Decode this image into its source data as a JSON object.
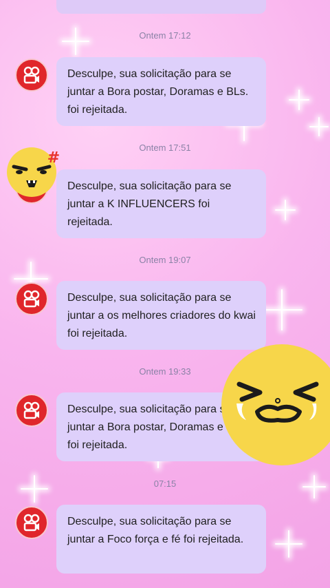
{
  "messages": [
    {
      "time": "Ontem 17:12",
      "text": "Desculpe, sua solicitação para se juntar a Bora postar, Doramas e BLs. foi rejeitada."
    },
    {
      "time": "Ontem 17:51",
      "text": "Desculpe, sua solicitação para se juntar a K INFLUENCERS foi rejeitada."
    },
    {
      "time": "Ontem 19:07",
      "text": "Desculpe, sua solicitação para se juntar a os melhores criadores do kwai foi rejeitada."
    },
    {
      "time": "Ontem 19:33",
      "text": "Desculpe, sua solicitação para se juntar a Bora postar, Doramas e BLs. foi rejeitada."
    },
    {
      "time": "07:15",
      "text": "Desculpe, sua solicitação para se juntar a Foco força e fé foi rejeitada."
    }
  ],
  "stickers": {
    "angry_mark": "#",
    "angry_icon": "angry-face-icon",
    "crying_icon": "crying-face-icon"
  },
  "colors": {
    "background": "#f9b5ee",
    "bubble": "#ded0fb",
    "avatar": "#e0262b",
    "timestamp": "#8a82a6"
  }
}
